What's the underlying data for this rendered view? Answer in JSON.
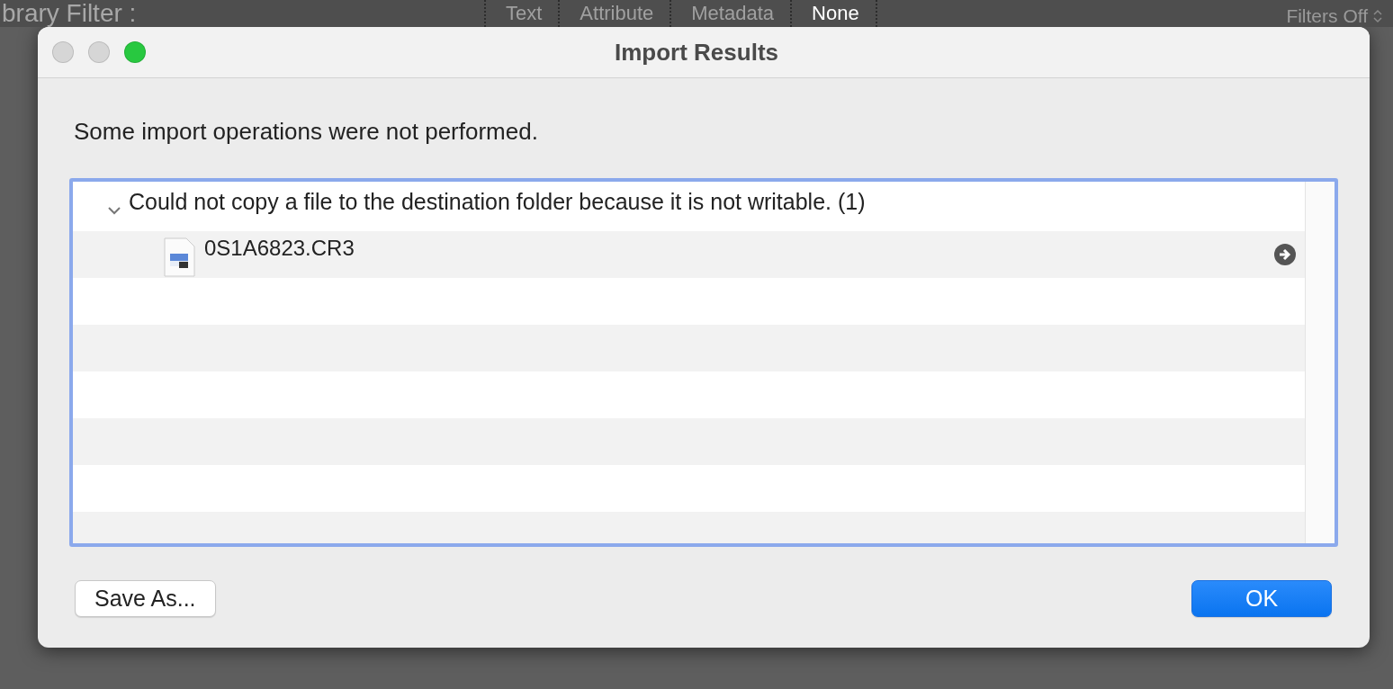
{
  "library_filter": {
    "label": "brary Filter :",
    "tabs": [
      {
        "label": "Text",
        "selected": false
      },
      {
        "label": "Attribute",
        "selected": false
      },
      {
        "label": "Metadata",
        "selected": false
      },
      {
        "label": "None",
        "selected": true
      }
    ],
    "status": "Filters Off"
  },
  "dialog": {
    "title": "Import Results",
    "window_controls": [
      {
        "kind": "close",
        "enabled": false
      },
      {
        "kind": "minimize",
        "enabled": false
      },
      {
        "kind": "zoom",
        "enabled": true
      }
    ],
    "message": "Some import operations were not performed.",
    "results": [
      {
        "message": "Could not copy a file to the destination folder because it is not writable. (1)",
        "expanded": true,
        "children": [
          {
            "name": "0S1A6823.CR3"
          }
        ]
      }
    ],
    "buttons": [
      {
        "label": "Save As...",
        "default": false
      },
      {
        "label": "OK",
        "default": true
      }
    ]
  }
}
